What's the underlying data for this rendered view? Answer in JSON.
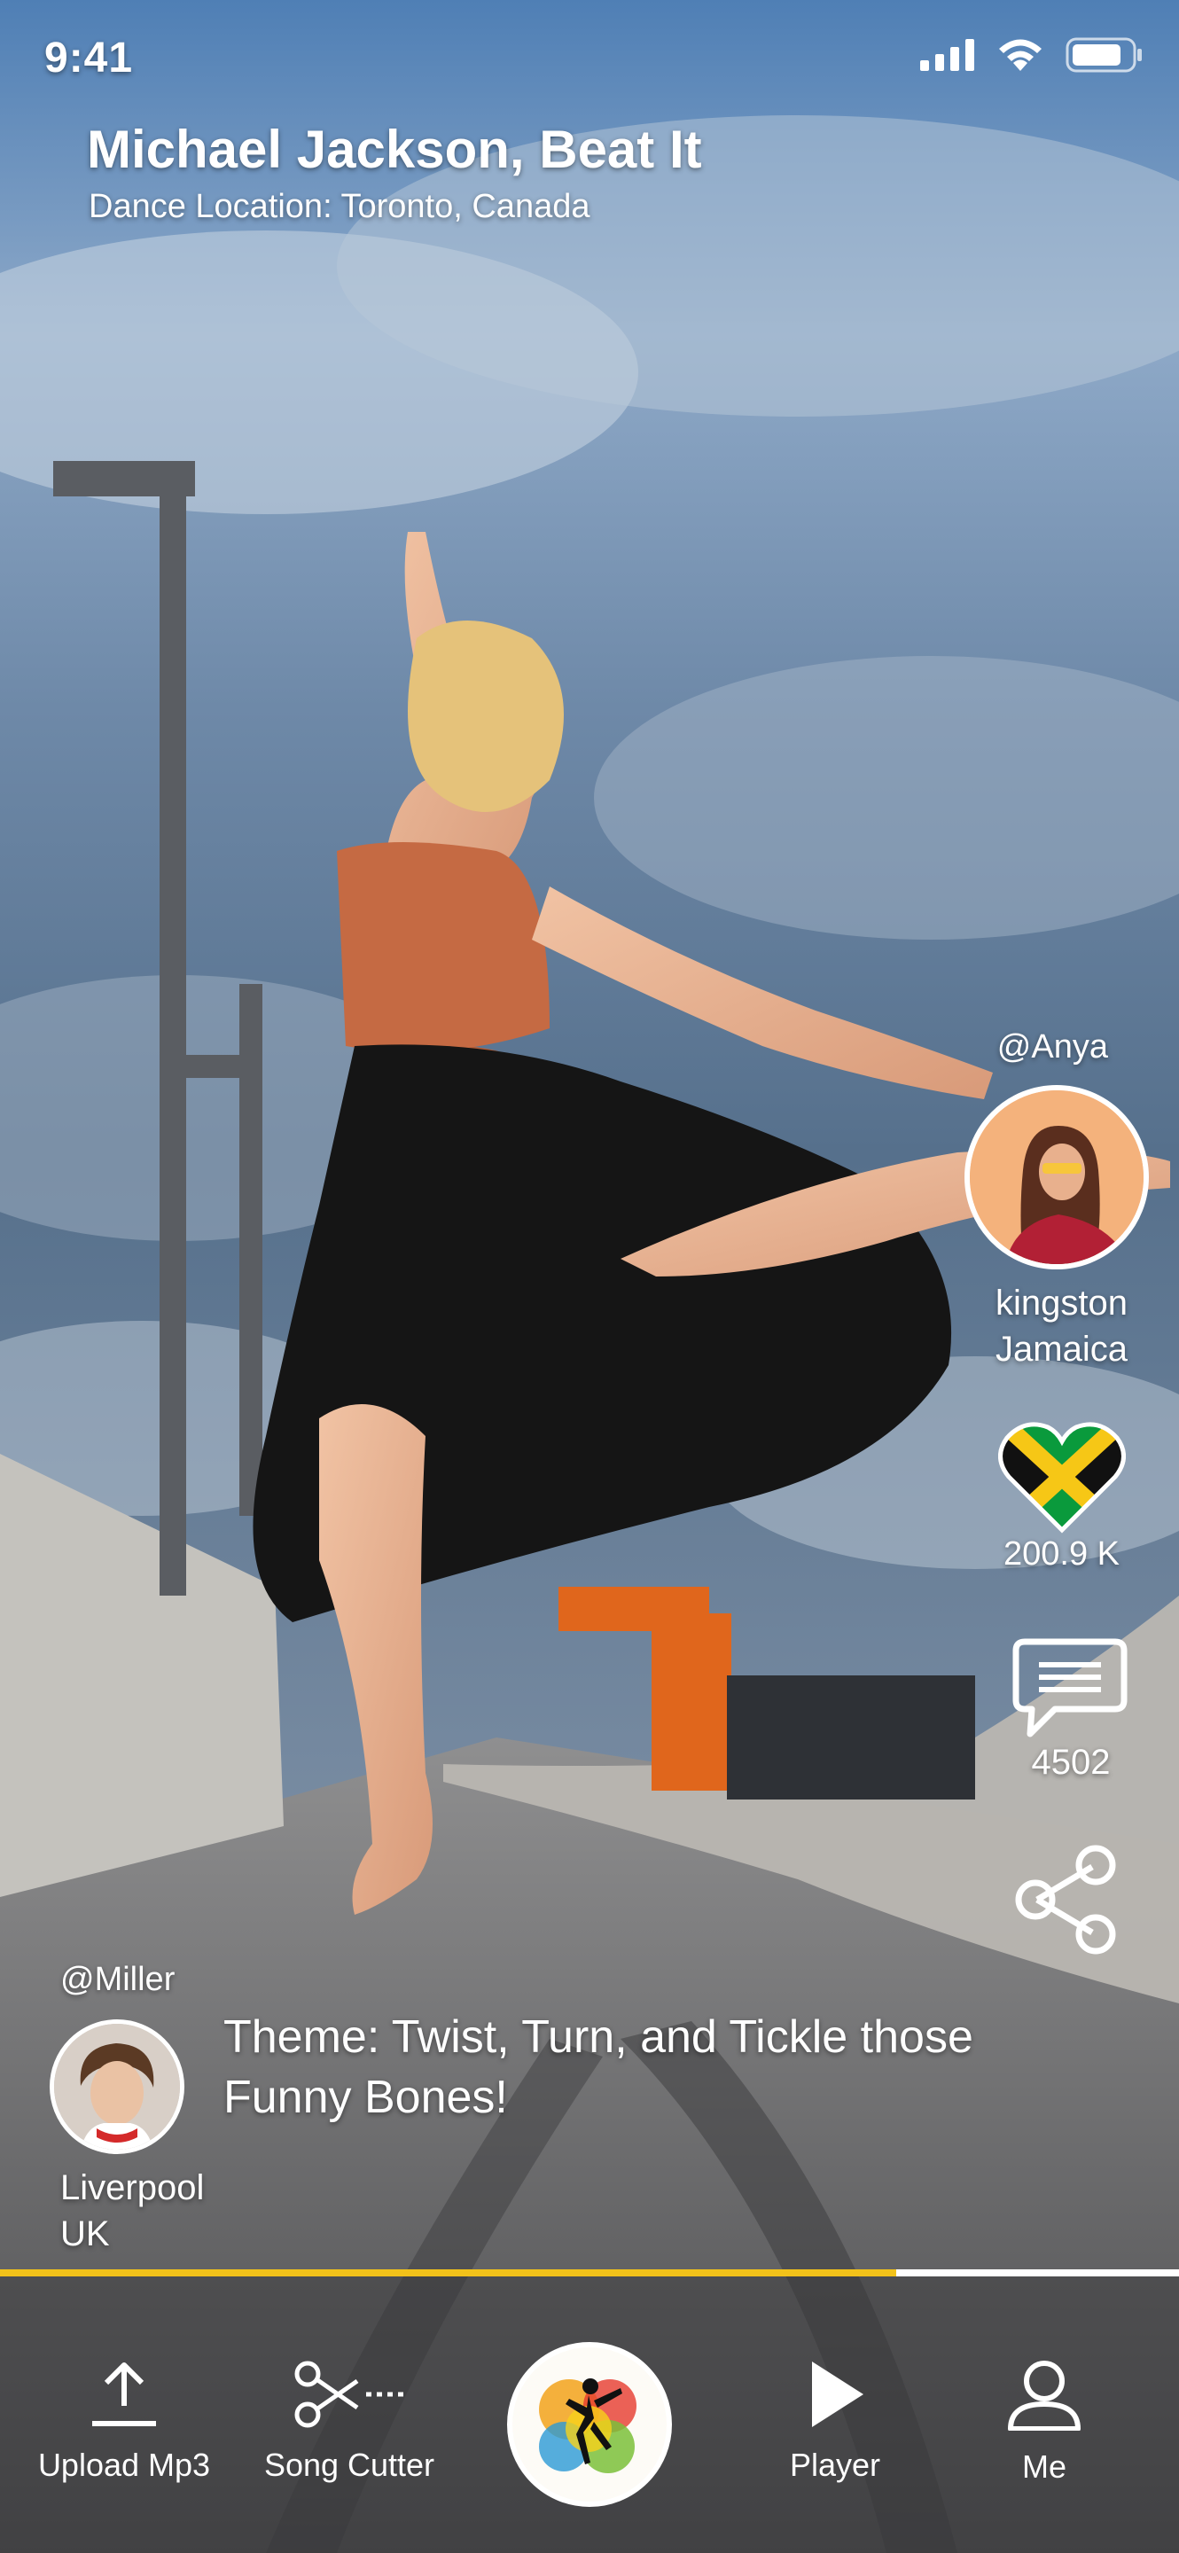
{
  "status_bar": {
    "time": "9:41"
  },
  "header": {
    "song_title": "Michael Jackson, Beat It",
    "dance_location": "Dance Location: Toronto, Canada"
  },
  "right_rail": {
    "handle": "@Anya",
    "location_line1": "kingston",
    "location_line2": "Jamaica",
    "likes": "200.9 K",
    "comments": "4502",
    "heart_flag": "jamaica-flag",
    "icons": [
      "jamaica-flag-heart-icon",
      "comment-icon",
      "share-icon"
    ]
  },
  "bottom_user": {
    "handle": "@Miller",
    "location_line1": "Liverpool",
    "location_line2": "UK",
    "theme": "Theme: Twist, Turn, and Tickle those Funny Bones!"
  },
  "progress": {
    "value": 0.76,
    "color": "#f2c21a"
  },
  "tab_bar": {
    "items": [
      {
        "label": "Upload Mp3",
        "icon": "upload-icon"
      },
      {
        "label": "Song Cutter",
        "icon": "scissors-icon"
      },
      {
        "label": "",
        "icon": "dancer-logo-icon"
      },
      {
        "label": "Player",
        "icon": "play-icon"
      },
      {
        "label": "Me",
        "icon": "user-icon"
      }
    ]
  }
}
